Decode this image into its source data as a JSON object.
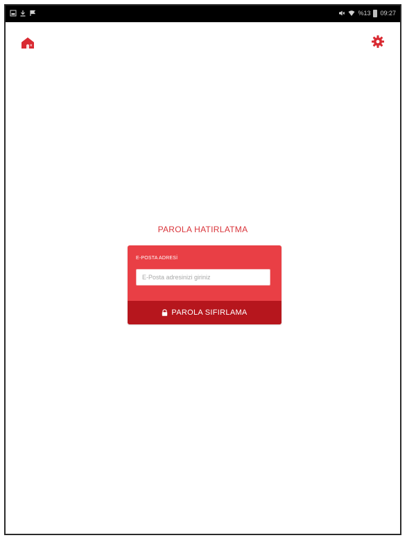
{
  "status_bar": {
    "battery": "%13",
    "time": "09:27"
  },
  "icons": {
    "home": "home-icon",
    "settings": "gear-icon",
    "lock": "lock-icon"
  },
  "page": {
    "title": "PAROLA HATIRLATMA"
  },
  "form": {
    "email_label": "E-POSTA ADRESİ",
    "email_placeholder": "E-Posta adresinizi giriniz",
    "email_value": "",
    "reset_button_label": "PAROLA SIFIRLAMA"
  },
  "colors": {
    "accent": "#e93f45",
    "accent_dark": "#b6161d",
    "title": "#d9343a"
  }
}
